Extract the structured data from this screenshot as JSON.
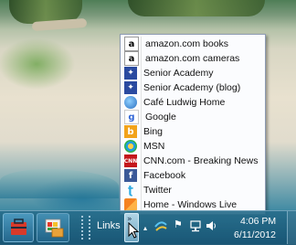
{
  "links_menu": {
    "items": [
      {
        "label": "amazon.com books",
        "icon": "amazon-icon"
      },
      {
        "label": "amazon.com cameras",
        "icon": "amazon-icon"
      },
      {
        "label": "Senior Academy",
        "icon": "senior-academy-icon"
      },
      {
        "label": "Senior Academy (blog)",
        "icon": "senior-academy-icon"
      },
      {
        "label": "Café Ludwig Home",
        "icon": "globe-icon"
      },
      {
        "label": "Google",
        "icon": "google-icon"
      },
      {
        "label": "Bing",
        "icon": "bing-icon"
      },
      {
        "label": "MSN",
        "icon": "msn-icon"
      },
      {
        "label": "CNN.com - Breaking News",
        "icon": "cnn-icon"
      },
      {
        "label": "Facebook",
        "icon": "facebook-icon"
      },
      {
        "label": "Twitter",
        "icon": "twitter-icon"
      },
      {
        "label": "Home - Windows Live",
        "icon": "windows-live-icon"
      }
    ]
  },
  "taskbar": {
    "links_label": "Links",
    "time": "4:06 PM",
    "date": "6/11/2012"
  },
  "colors": {
    "taskbar": "#1f5f7e",
    "menu_border": "#8d9bb3",
    "accent": "#3b8fd0"
  }
}
